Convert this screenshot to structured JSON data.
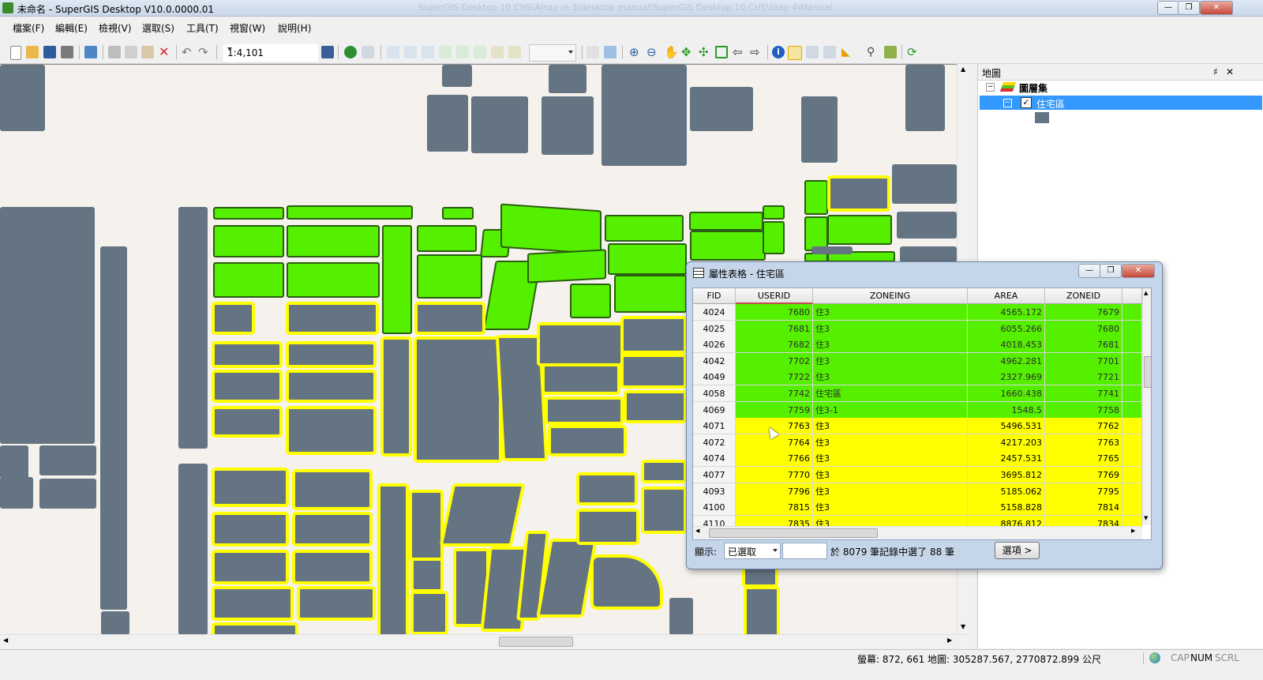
{
  "window": {
    "title": "未命名 - SuperGIS Desktop V10.0.0000.01",
    "ghost_title": "SuperGIS Desktop 10 CHS\\Array in 3\\desktop manual\\SuperGIS Desktop 10 CHS\\Step 4\\Manual",
    "minimize": "—",
    "maximize": "❐",
    "close": "✕"
  },
  "menu": [
    "檔案(F)",
    "編輯(E)",
    "檢視(V)",
    "選取(S)",
    "工具(T)",
    "視窗(W)",
    "說明(H)"
  ],
  "toolbar": {
    "scale": "1:4,101",
    "zoom_combo": ""
  },
  "map_panel": {
    "title": "地圖",
    "pin": "♯",
    "close": "✕",
    "root_label": "圖層集",
    "layer_label": "住宅區",
    "layer_checked": true
  },
  "dialog": {
    "title": "屬性表格 - 住宅區",
    "columns": [
      "FID",
      "USERID",
      "ZONEING",
      "AREA",
      "ZONEID"
    ],
    "rows": [
      {
        "fid": "4024",
        "userid": "7680",
        "zone": "住3",
        "area": "4565.172",
        "zoneid": "7679",
        "state": "green"
      },
      {
        "fid": "4025",
        "userid": "7681",
        "zone": "住3",
        "area": "6055.266",
        "zoneid": "7680",
        "state": "green"
      },
      {
        "fid": "4026",
        "userid": "7682",
        "zone": "住3",
        "area": "4018.453",
        "zoneid": "7681",
        "state": "green"
      },
      {
        "fid": "4042",
        "userid": "7702",
        "zone": "住3",
        "area": "4962.281",
        "zoneid": "7701",
        "state": "green"
      },
      {
        "fid": "4049",
        "userid": "7722",
        "zone": "住3",
        "area": "2327.969",
        "zoneid": "7721",
        "state": "green"
      },
      {
        "fid": "4058",
        "userid": "7742",
        "zone": "住宅區",
        "area": "1660.438",
        "zoneid": "7741",
        "state": "green"
      },
      {
        "fid": "4069",
        "userid": "7759",
        "zone": "住3-1",
        "area": "1548.5",
        "zoneid": "7758",
        "state": "green"
      },
      {
        "fid": "4071",
        "userid": "7763",
        "zone": "住3",
        "area": "5496.531",
        "zoneid": "7762",
        "state": "yellow"
      },
      {
        "fid": "4072",
        "userid": "7764",
        "zone": "住3",
        "area": "4217.203",
        "zoneid": "7763",
        "state": "yellow"
      },
      {
        "fid": "4074",
        "userid": "7766",
        "zone": "住3",
        "area": "2457.531",
        "zoneid": "7765",
        "state": "yellow"
      },
      {
        "fid": "4077",
        "userid": "7770",
        "zone": "住3",
        "area": "3695.812",
        "zoneid": "7769",
        "state": "yellow"
      },
      {
        "fid": "4093",
        "userid": "7796",
        "zone": "住3",
        "area": "5185.062",
        "zoneid": "7795",
        "state": "yellow"
      },
      {
        "fid": "4100",
        "userid": "7815",
        "zone": "住3",
        "area": "5158.828",
        "zoneid": "7814",
        "state": "yellow"
      },
      {
        "fid": "4110",
        "userid": "7835",
        "zone": "住3",
        "area": "8876.812",
        "zoneid": "7834",
        "state": "yellow"
      }
    ],
    "show_label": "顯示:",
    "show_value": "已選取",
    "record_input": "",
    "record_summary": "於 8079 筆記錄中選了 88 筆",
    "options_button": "選項 >",
    "colors": {
      "selected": "#55f000",
      "highlight": "#ffff00"
    }
  },
  "status": {
    "screen": "螢幕: 872, 661",
    "map": "地圖: 305287.567, 2770872.899 公尺",
    "cap": "CAP",
    "num": "NUM",
    "scrl": "SCRL"
  },
  "legend": {
    "symbol_color": "#657483"
  }
}
